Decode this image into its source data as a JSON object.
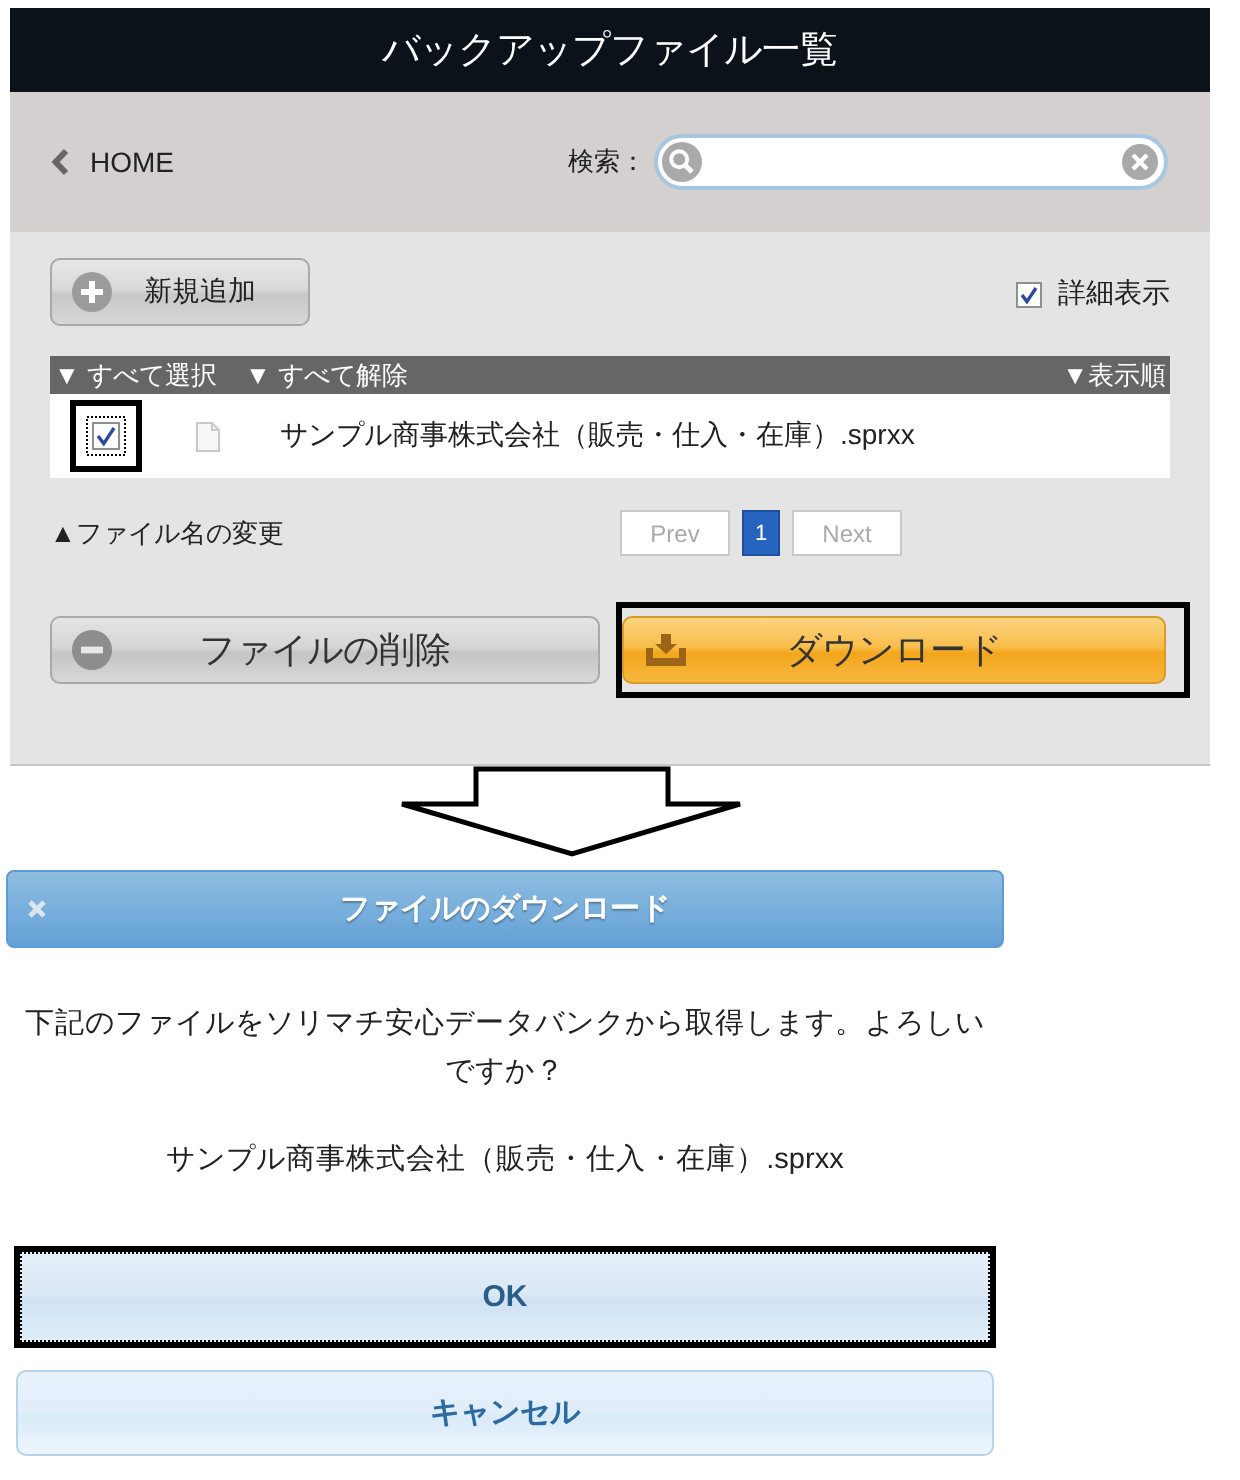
{
  "header": {
    "title": "バックアップファイル一覧"
  },
  "nav": {
    "back_link": "HOME",
    "search_label": "検索："
  },
  "toolbar": {
    "add_button": "新規追加",
    "detail": {
      "label": "詳細表示",
      "checked": true
    }
  },
  "list_header": {
    "select_all": "▼ すべて選択",
    "deselect_all": "▼ すべて解除",
    "sort": "▼表示順"
  },
  "files": [
    {
      "name": "サンプル商事株式会社（販売・仕入・在庫）.sprxx",
      "checked": true,
      "highlighted": true
    }
  ],
  "rename_link": "▲ファイル名の変更",
  "pagination": {
    "prev": {
      "label": "Prev",
      "disabled": true
    },
    "pages": [
      {
        "label": "1",
        "selected": true
      }
    ],
    "next": {
      "label": "Next",
      "disabled": true
    }
  },
  "actions": [
    {
      "kind": "delete",
      "label": "ファイルの削除",
      "highlighted": false
    },
    {
      "kind": "download",
      "label": "ダウンロード",
      "highlighted": true
    }
  ],
  "dialog": {
    "title": "ファイルのダウンロード",
    "message": "下記のファイルをソリマチ安心データバンクから取得します。よろしいですか？",
    "file_name": "サンプル商事株式会社（販売・仕入・在庫）.sprxx",
    "buttons": [
      {
        "kind": "ok",
        "label": "OK",
        "highlighted": true
      },
      {
        "kind": "cancel",
        "label": "キャンセル",
        "highlighted": false
      }
    ]
  }
}
